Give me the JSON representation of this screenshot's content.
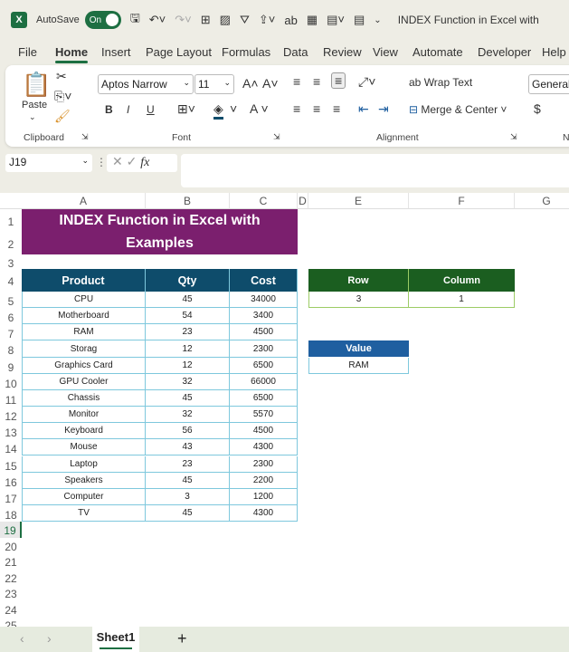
{
  "titlebar": {
    "autosave_label": "AutoSave",
    "toggle_label": "On",
    "doc_title": "INDEX Function in Excel with"
  },
  "menu": [
    "File",
    "Home",
    "Insert",
    "Page Layout",
    "Formulas",
    "Data",
    "Review",
    "View",
    "Automate",
    "Developer",
    "Help"
  ],
  "ribbon": {
    "paste": "Paste",
    "font_name": "Aptos Narrow",
    "font_size": "11",
    "bold": "B",
    "italic": "I",
    "underline": "U",
    "wrap_text": "Wrap Text",
    "merge_center": "Merge & Center",
    "number_format": "General",
    "currency": "$",
    "groups": {
      "clipboard": "Clipboard",
      "font": "Font",
      "alignment": "Alignment",
      "number": "N"
    }
  },
  "formula_bar": {
    "name_box": "J19",
    "fx": "fx",
    "formula": ""
  },
  "columns": [
    "A",
    "B",
    "C",
    "D",
    "E",
    "F",
    "G"
  ],
  "rows": [
    "1",
    "2",
    "3",
    "4",
    "5",
    "6",
    "7",
    "8",
    "9",
    "10",
    "11",
    "12",
    "13",
    "14",
    "15",
    "16",
    "17",
    "18",
    "19",
    "20",
    "21",
    "22",
    "23",
    "24",
    "25"
  ],
  "title": "INDEX Function in Excel with Examples",
  "table": {
    "headers": [
      "Product",
      "Qty",
      "Cost"
    ],
    "rows": [
      [
        "CPU",
        "45",
        "34000"
      ],
      [
        "Motherboard",
        "54",
        "3400"
      ],
      [
        "RAM",
        "23",
        "4500"
      ],
      [
        "Storag",
        "12",
        "2300"
      ],
      [
        "Graphics Card",
        "12",
        "6500"
      ],
      [
        "GPU Cooler",
        "32",
        "66000"
      ],
      [
        "Chassis",
        "45",
        "6500"
      ],
      [
        "Monitor",
        "32",
        "5570"
      ],
      [
        "Keyboard",
        "56",
        "4500"
      ],
      [
        "Mouse",
        "43",
        "4300"
      ],
      [
        "Laptop",
        "23",
        "2300"
      ],
      [
        "Speakers",
        "45",
        "2200"
      ],
      [
        "Computer",
        "3",
        "1200"
      ],
      [
        "TV",
        "45",
        "4300"
      ]
    ]
  },
  "lookup": {
    "row_label": "Row",
    "column_label": "Column",
    "row_value": "3",
    "column_value": "1",
    "value_label": "Value",
    "value_result": "RAM"
  },
  "sheet_tabs": [
    "Sheet1"
  ],
  "colors": {
    "title_bg": "#7b1f6e",
    "table_header": "#0e4c6b",
    "table_border": "#7ec8dd",
    "lookup_header": "#1b5e20",
    "lookup_border": "#9ccc65",
    "value_header": "#1f5fa0",
    "excel_green": "#1d6f42"
  }
}
